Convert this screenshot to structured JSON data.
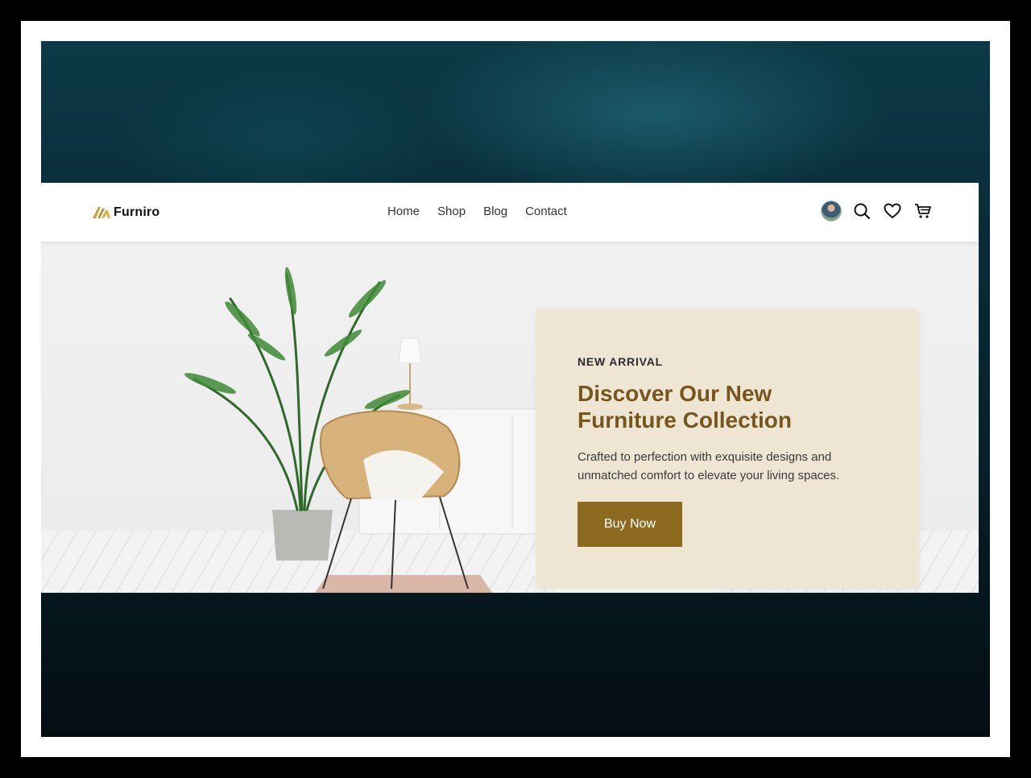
{
  "brand": {
    "name": "Furniro",
    "logo_icon": "furniro-logo-icon"
  },
  "nav": {
    "links": [
      "Home",
      "Shop",
      "Blog",
      "Contact"
    ]
  },
  "header_icons": [
    "avatar",
    "search-icon",
    "heart-icon",
    "cart-icon"
  ],
  "hero": {
    "eyebrow": "NEW ARRIVAL",
    "title": "Discover Our New Furniture Collection",
    "description": "Crafted to perfection with exquisite designs and unmatched comfort to elevate your living spaces.",
    "cta_label": "Buy Now"
  },
  "colors": {
    "accent": "#8c6a1f",
    "title": "#76561d",
    "card_bg": "#efe5d3",
    "logo_gold": "#c9a13b"
  }
}
